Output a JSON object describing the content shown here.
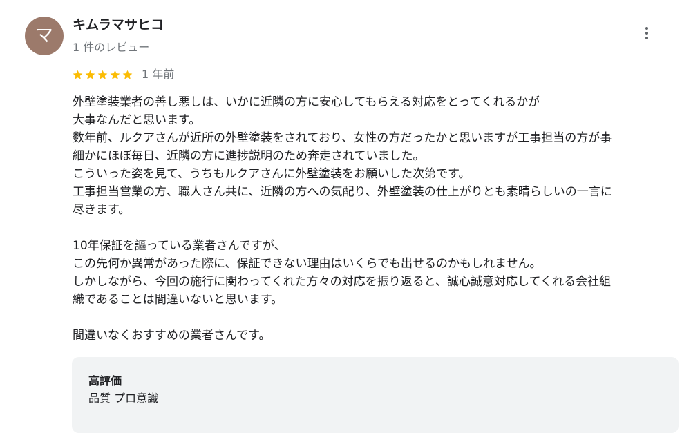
{
  "reviewer": {
    "avatar_initial": "マ",
    "avatar_color": "#9c7a6b",
    "name": "キムラマサヒコ",
    "review_count": "1 件のレビュー"
  },
  "menu": {
    "icon": "more-vert-icon"
  },
  "rating": {
    "stars": 5,
    "max_stars": 5,
    "star_color": "#fbbc04",
    "date": "1 年前"
  },
  "review": {
    "lines": [
      "外壁塗装業者の善し悪しは、いかに近隣の方に安心してもらえる対応をとってくれるかが",
      "大事なんだと思います。",
      "数年前、ルクアさんが近所の外壁塗装をされており、女性の方だったかと思いますが工事担当の方が事",
      "細かにほぼ毎日、近隣の方に進捗説明のため奔走されていました。",
      "こういった姿を見て、うちもルクアさんに外壁塗装をお願いした次第です。",
      "工事担当営業の方、職人さん共に、近隣の方への気配り、外壁塗装の仕上がりとも素晴らしいの一言に",
      "尽きます。",
      "",
      "10年保証を謳っている業者さんですが、",
      "この先何か異常があった際に、保証できない理由はいくらでも出せるのかもしれません。",
      "しかしながら、今回の施行に関わってくれた方々の対応を振り返ると、誠心誠意対応してくれる会社組",
      "織であることは間違いないと思います。",
      "",
      "間違いなくおすすめの業者さんです。"
    ]
  },
  "highlights": {
    "title": "高評価",
    "items": "品質 プロ意識"
  }
}
